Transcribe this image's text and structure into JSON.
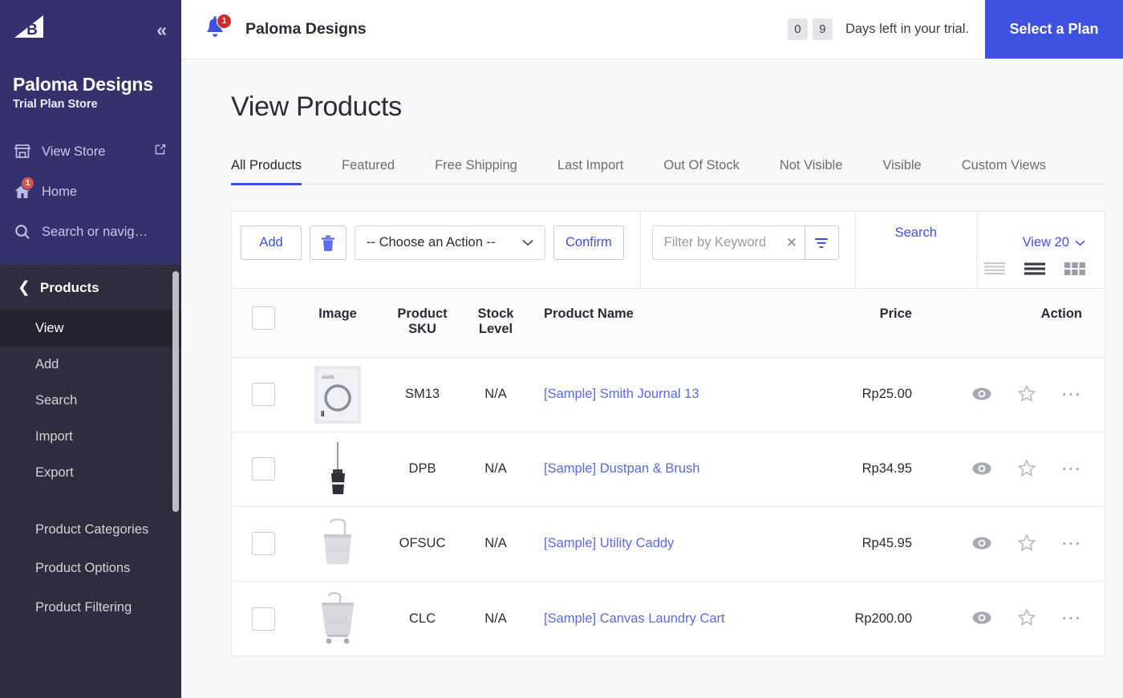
{
  "sidebar": {
    "logo_icon": "bigcommerce-logo",
    "collapse_icon": "collapse-chevrons",
    "store_name": "Paloma Designs",
    "store_plan": "Trial Plan Store",
    "links": [
      {
        "label": "View Store",
        "icon": "store-icon",
        "external_icon": "external-link-icon",
        "badge": ""
      },
      {
        "label": "Home",
        "icon": "home-icon",
        "badge": "1"
      },
      {
        "label": "Search or navig…",
        "icon": "search-icon",
        "badge": ""
      }
    ],
    "submenu": {
      "title": "Products",
      "back_icon": "chevron-left-icon",
      "items": [
        {
          "label": "View",
          "active": true
        },
        {
          "label": "Add",
          "active": false
        },
        {
          "label": "Search",
          "active": false
        },
        {
          "label": "Import",
          "active": false
        },
        {
          "label": "Export",
          "active": false
        }
      ],
      "items_group2": [
        {
          "label": "Product Categories"
        },
        {
          "label": "Product Options"
        },
        {
          "label": "Product Filtering"
        }
      ]
    },
    "colors": {
      "bg": "#34316e",
      "sub_bg": "#2f2d3d",
      "active_bg": "#24222f"
    }
  },
  "topbar": {
    "bell_icon": "notification-bell-icon",
    "bell_badge": "1",
    "title": "Paloma Designs",
    "trial_digits": [
      "0",
      "9"
    ],
    "trial_text": "Days left in your trial.",
    "plan_button": "Select a Plan",
    "accent": "#3f51e0"
  },
  "page": {
    "title": "View Products",
    "tabs": [
      {
        "label": "All Products",
        "active": true
      },
      {
        "label": "Featured",
        "active": false
      },
      {
        "label": "Free Shipping",
        "active": false
      },
      {
        "label": "Last Import",
        "active": false
      },
      {
        "label": "Out Of Stock",
        "active": false
      },
      {
        "label": "Not Visible",
        "active": false
      },
      {
        "label": "Visible",
        "active": false
      },
      {
        "label": "Custom Views",
        "active": false
      }
    ]
  },
  "toolbar": {
    "add_label": "Add",
    "delete_icon": "trash-icon",
    "action_select_value": "-- Choose an Action --",
    "caret_icon": "chevron-down-icon",
    "confirm_label": "Confirm",
    "filter_placeholder": "Filter by Keyword",
    "filter_value": "",
    "clear_icon": "clear-x-icon",
    "filter_icon": "filter-funnel-icon",
    "search_label": "Search",
    "view_count_label": "View 20",
    "view_modes": [
      {
        "name": "compact-list-view-icon",
        "active": false
      },
      {
        "name": "list-view-icon",
        "active": true
      },
      {
        "name": "grid-view-icon",
        "active": false
      }
    ]
  },
  "table": {
    "select_all_checkbox": "select-all-checkbox",
    "headers": {
      "image": "Image",
      "sku": "Product SKU",
      "sku_line1": "Product",
      "sku_line2": "SKU",
      "stock_line1": "Stock",
      "stock_line2": "Level",
      "name": "Product Name",
      "price": "Price",
      "action": "Action"
    },
    "rows": [
      {
        "sku": "SM13",
        "stock": "N/A",
        "name": "[Sample] Smith Journal 13",
        "price": "Rp25.00",
        "thumb": "journal-thumbnail",
        "preview_icon": "eye-icon",
        "favorite_icon": "star-icon",
        "more_icon": "more-options-icon"
      },
      {
        "sku": "DPB",
        "stock": "N/A",
        "name": "[Sample] Dustpan & Brush",
        "price": "Rp34.95",
        "thumb": "dustpan-thumbnail",
        "preview_icon": "eye-icon",
        "favorite_icon": "star-icon",
        "more_icon": "more-options-icon"
      },
      {
        "sku": "OFSUC",
        "stock": "N/A",
        "name": "[Sample] Utility Caddy",
        "price": "Rp45.95",
        "thumb": "caddy-thumbnail",
        "preview_icon": "eye-icon",
        "favorite_icon": "star-icon",
        "more_icon": "more-options-icon"
      },
      {
        "sku": "CLC",
        "stock": "N/A",
        "name": "[Sample] Canvas Laundry Cart",
        "price": "Rp200.00",
        "thumb": "laundry-cart-thumbnail",
        "preview_icon": "eye-icon",
        "favorite_icon": "star-icon",
        "more_icon": "more-options-icon"
      }
    ]
  }
}
